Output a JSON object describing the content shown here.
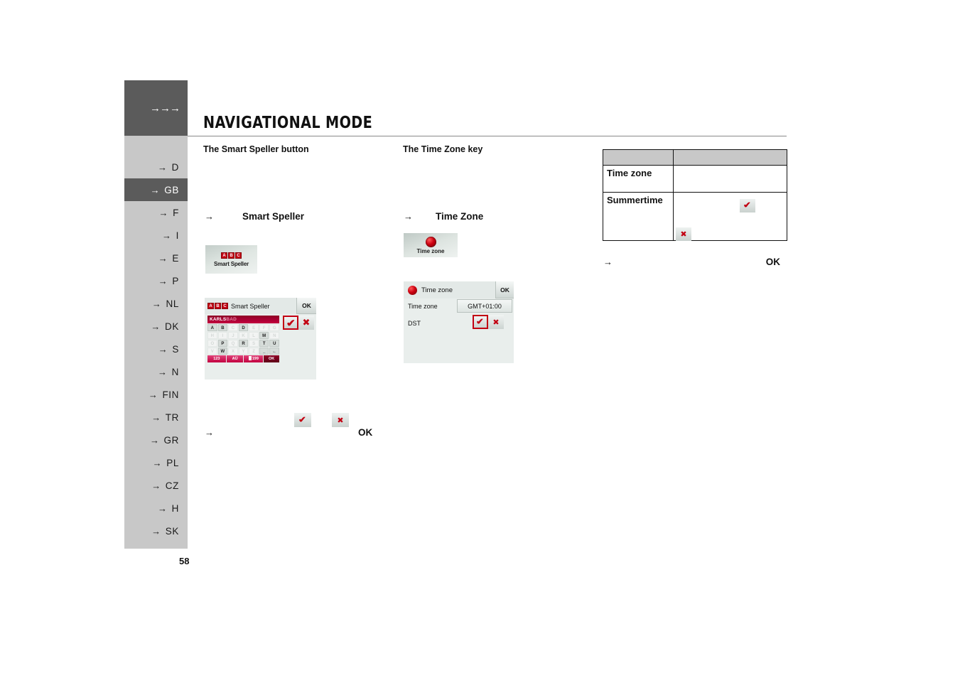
{
  "document": {
    "title": "NAVIGATIONAL MODE",
    "page_number": "58",
    "sidebar_arrows": "→→→"
  },
  "sidebar": {
    "items": [
      {
        "label": "D",
        "active": false
      },
      {
        "label": "GB",
        "active": true
      },
      {
        "label": "F",
        "active": false
      },
      {
        "label": "I",
        "active": false
      },
      {
        "label": "E",
        "active": false
      },
      {
        "label": "P",
        "active": false
      },
      {
        "label": "NL",
        "active": false
      },
      {
        "label": "DK",
        "active": false
      },
      {
        "label": "S",
        "active": false
      },
      {
        "label": "N",
        "active": false
      },
      {
        "label": "FIN",
        "active": false
      },
      {
        "label": "TR",
        "active": false
      },
      {
        "label": "GR",
        "active": false
      },
      {
        "label": "PL",
        "active": false
      },
      {
        "label": "CZ",
        "active": false
      },
      {
        "label": "H",
        "active": false
      },
      {
        "label": "SK",
        "active": false
      }
    ]
  },
  "columns": {
    "left_heading": "The Smart Speller button",
    "mid_heading": "The Time Zone key"
  },
  "bullets": {
    "arrow": "→",
    "left_label": "Smart  Speller",
    "mid_label": "Time Zone",
    "bottom_label": "OK",
    "right_label": "OK"
  },
  "smart_speller_button": {
    "label": "Smart Speller",
    "logo_letters": [
      "A",
      "B",
      "C"
    ]
  },
  "smart_speller_dialog": {
    "title": "Smart Speller",
    "ok_label": "OK",
    "logo_letters": [
      "A",
      "B",
      "C"
    ],
    "input_typed": "KARLS",
    "input_suggestion": "BAD",
    "keyboard_rows": [
      [
        {
          "k": "A",
          "on": true
        },
        {
          "k": "B",
          "on": true
        },
        {
          "k": "C",
          "on": false
        },
        {
          "k": "D",
          "on": true
        },
        {
          "k": "E",
          "on": false
        },
        {
          "k": "F",
          "on": false
        },
        {
          "k": "G",
          "on": false
        }
      ],
      [
        {
          "k": "H",
          "on": false
        },
        {
          "k": "I",
          "on": false
        },
        {
          "k": "J",
          "on": false
        },
        {
          "k": "K",
          "on": false
        },
        {
          "k": "L",
          "on": false
        },
        {
          "k": "M",
          "on": true
        },
        {
          "k": "N",
          "on": false
        }
      ],
      [
        {
          "k": "O",
          "on": false
        },
        {
          "k": "P",
          "on": true
        },
        {
          "k": "Q",
          "on": false
        },
        {
          "k": "R",
          "on": true
        },
        {
          "k": "S",
          "on": false
        },
        {
          "k": "T",
          "on": true
        },
        {
          "k": "U",
          "on": true
        }
      ],
      [
        {
          "k": "V",
          "on": false
        },
        {
          "k": "W",
          "on": true
        },
        {
          "k": "X",
          "on": false
        },
        {
          "k": "Y",
          "on": false
        },
        {
          "k": "Z",
          "on": false
        },
        {
          "k": "_",
          "on": true
        },
        {
          "k": "←",
          "on": true
        }
      ]
    ],
    "function_keys": [
      {
        "label": "123",
        "dark": false
      },
      {
        "label": "AÜ",
        "dark": false
      },
      {
        "label": "199",
        "dark": false,
        "has_list_icon": true
      },
      {
        "label": "OK",
        "dark": true
      }
    ],
    "confirm_icon": "check-icon",
    "cancel_icon": "cross-icon"
  },
  "time_zone_button": {
    "label": "Time zone",
    "icon": "globe-icon"
  },
  "time_zone_dialog": {
    "title": "Time zone",
    "ok_label": "OK",
    "icon": "globe-icon",
    "rows": [
      {
        "label": "Time zone",
        "value": "GMT+01:00"
      },
      {
        "label": "DST",
        "value": ""
      }
    ],
    "dst_confirm_icon": "check-icon",
    "dst_cancel_icon": "cross-icon"
  },
  "table": {
    "header": [
      "",
      ""
    ],
    "rows": [
      {
        "label": "Time zone",
        "value": ""
      },
      {
        "label": "Summertime",
        "value": ""
      }
    ]
  },
  "colors": {
    "sidebar_bg": "#c8c8c8",
    "sidebar_active": "#5b5b5b",
    "accent_red": "#c20012",
    "keyboard_pink": "#c2003f",
    "device_bg": "#e9eeec"
  }
}
